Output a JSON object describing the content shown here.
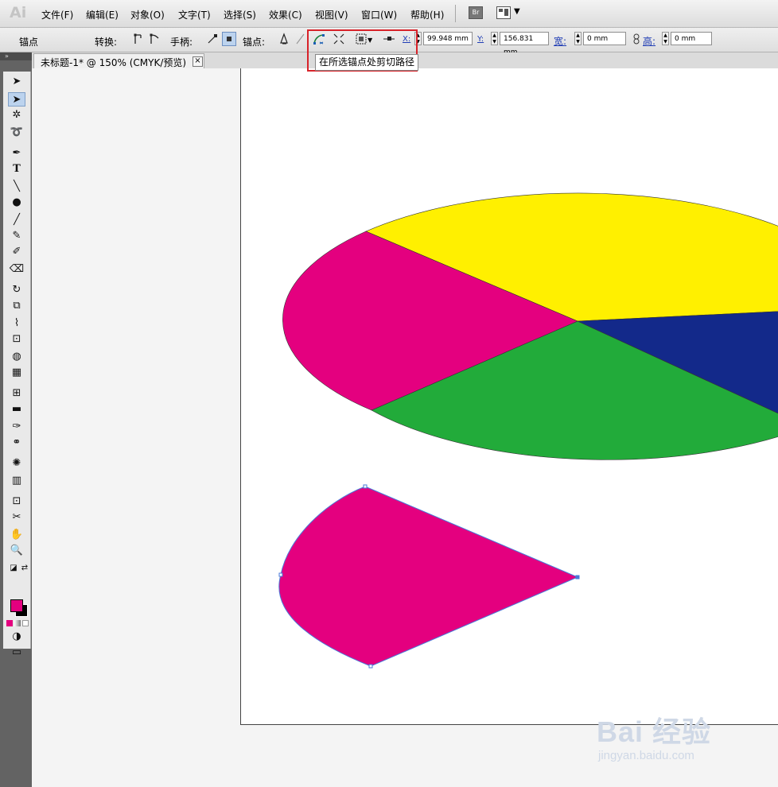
{
  "app": {
    "logo": "Ai"
  },
  "menu": {
    "items": [
      "文件(F)",
      "编辑(E)",
      "对象(O)",
      "文字(T)",
      "选择(S)",
      "效果(C)",
      "视图(V)",
      "窗口(W)",
      "帮助(H)"
    ],
    "bridge_label": "Br"
  },
  "control": {
    "mode_label": "锚点",
    "convert_label": "转换:",
    "handles_label": "手柄:",
    "anchors_label": "锚点:",
    "x_label": "X:",
    "x_value": "99.948 mm",
    "y_label": "Y:",
    "y_value": "156.831 mm",
    "w_label": "宽:",
    "w_value": "0 mm",
    "h_label": "高:",
    "h_value": "0 mm",
    "tooltip": "在所选锚点处剪切路径"
  },
  "document": {
    "tab_label": "未标题-1* @ 150% (CMYK/预览)",
    "close_glyph": "×"
  },
  "colors": {
    "magenta": "#e4007f",
    "yellow": "#fff000",
    "navy": "#13298a",
    "green": "#22ab3a",
    "selection": "#4a78d8",
    "highlight": "#d8232a"
  },
  "watermark": {
    "brand": "Bai 经验",
    "url": "jingyan.baidu.com"
  }
}
